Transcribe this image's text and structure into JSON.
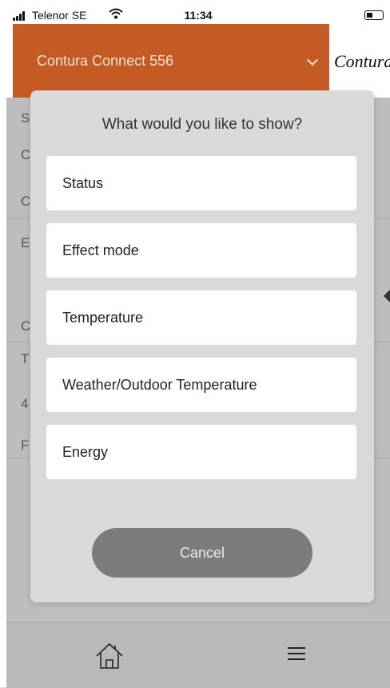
{
  "status_bar": {
    "carrier": "Telenor SE",
    "time": "11:34"
  },
  "header": {
    "device_name": "Contura Connect 556",
    "brand": "Contura"
  },
  "background_glyphs": [
    "S",
    "C",
    "C",
    "E",
    "C",
    "T",
    "4",
    "F"
  ],
  "dialog": {
    "title": "What would you like to show?",
    "options": [
      {
        "label": "Status"
      },
      {
        "label": "Effect mode"
      },
      {
        "label": "Temperature"
      },
      {
        "label": "Weather/Outdoor Temperature"
      },
      {
        "label": "Energy"
      }
    ],
    "cancel_label": "Cancel"
  },
  "tab_bar": {
    "items": [
      {
        "icon": "home-icon"
      },
      {
        "icon": "menu-icon"
      }
    ]
  },
  "colors": {
    "accent": "#c45b25",
    "cancel_button": "#7c7c7c",
    "overlay": "#bdbdbd"
  }
}
